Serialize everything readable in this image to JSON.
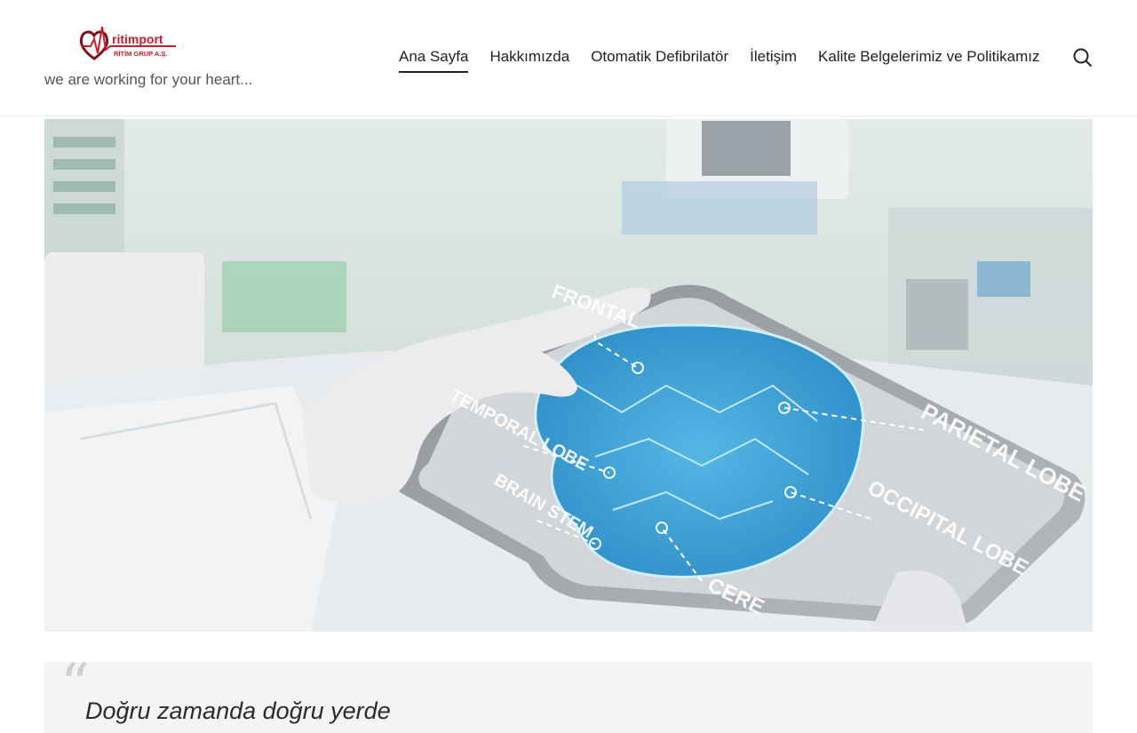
{
  "brand": {
    "logo_text": "ritimport",
    "logo_subtext": "RİTİM GRUP A.Ş.",
    "tagline": "we are working for your heart..."
  },
  "nav": {
    "items": [
      {
        "label": "Ana Sayfa",
        "active": true
      },
      {
        "label": "Hakkımızda",
        "active": false
      },
      {
        "label": "Otomatik Defibrilatör",
        "active": false
      },
      {
        "label": "İletişim",
        "active": false
      },
      {
        "label": "Kalite Belgelerimiz ve Politikamız",
        "active": false
      }
    ],
    "search_icon": "search-icon"
  },
  "hero": {
    "labels": {
      "frontal": "FRONTAL",
      "temporal": "TEMPORAL LOBE",
      "brain_stem": "BRAIN STEM",
      "parietal": "PARIETAL LOBE",
      "occipital": "OCCIPITAL LOBE",
      "cerebellum": "CERE"
    }
  },
  "quote": {
    "mark": "“",
    "text": "Doğru zamanda doğru yerde"
  },
  "colors": {
    "accent": "#c0202a",
    "text": "#222222",
    "brain_blue": "#3a9fd6"
  }
}
